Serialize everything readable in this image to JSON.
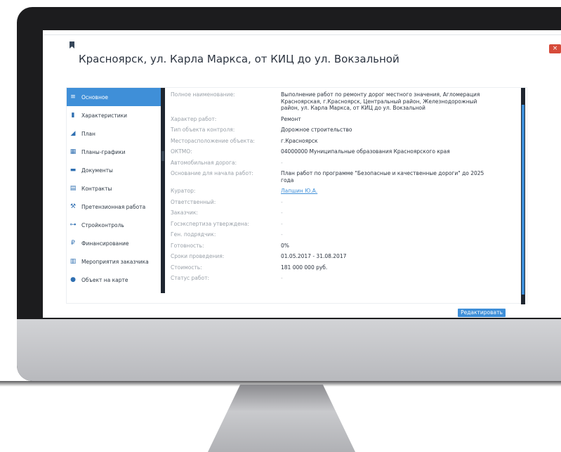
{
  "window": {
    "title": "Красноярск, ул. Карла Маркса, от КИЦ до ул. Вокзальной",
    "close_label": "×",
    "edit_button": "Редактировать"
  },
  "sidebar": {
    "items": [
      {
        "label": "Основное",
        "icon": "menu-icon",
        "glyph": "≡"
      },
      {
        "label": "Характеристики",
        "icon": "bar-chart-icon",
        "glyph": "▮"
      },
      {
        "label": "План",
        "icon": "area-chart-icon",
        "glyph": "◢"
      },
      {
        "label": "Планы-графики",
        "icon": "calendar-icon",
        "glyph": "▦"
      },
      {
        "label": "Документы",
        "icon": "folder-icon",
        "glyph": "▬"
      },
      {
        "label": "Контракты",
        "icon": "contract-icon",
        "glyph": "▤"
      },
      {
        "label": "Претензионная работа",
        "icon": "gavel-icon",
        "glyph": "⚒"
      },
      {
        "label": "Стройконтроль",
        "icon": "road-icon",
        "glyph": "⊶"
      },
      {
        "label": "Финансирование",
        "icon": "ruble-icon",
        "glyph": "₽"
      },
      {
        "label": "Мероприятия заказчика",
        "icon": "clipboard-icon",
        "glyph": "▥"
      },
      {
        "label": "Объект на карте",
        "icon": "map-pin-icon",
        "glyph": "●"
      }
    ]
  },
  "details": [
    {
      "label": "Полное наименование:",
      "value": "Выполнение работ по ремонту дорог местного значения, Агломерация Красноярская, г.Красноярск, Центральный район, Железнодорожный район, ул. Карла Маркса, от КИЦ до ул. Вокзальной"
    },
    {
      "label": "Характер работ:",
      "value": "Ремонт"
    },
    {
      "label": "Тип объекта контроля:",
      "value": "Дорожное строительство"
    },
    {
      "label": "Месторасположение объекта:",
      "value": "г.Красноярск"
    },
    {
      "label": "ОКТМО:",
      "value": "04000000 Муниципальные образования Красноярского края"
    },
    {
      "label": "Автомобильная дорога:",
      "value": "-"
    },
    {
      "label": "Основание для начала работ:",
      "value": "План работ по программе \"Безопасные и качественные дороги\" до 2025 года"
    },
    {
      "label": "Куратор:",
      "value": "Лапшин Ю.А."
    },
    {
      "label": "Ответственный:",
      "value": "-"
    },
    {
      "label": "Заказчик:",
      "value": "-"
    },
    {
      "label": "Госэкспертиза утверждена:",
      "value": "-"
    },
    {
      "label": "Ген. подрядчик:",
      "value": "-"
    },
    {
      "label": "Готовность:",
      "value": "0%"
    },
    {
      "label": "Сроки проведения:",
      "value": "01.05.2017 - 31.08.2017"
    },
    {
      "label": "Стоимость:",
      "value": "181 000 000 руб."
    },
    {
      "label": "Статус работ:",
      "value": "-"
    }
  ],
  "colors": {
    "accent": "#3f8fd8",
    "close": "#d64b3a",
    "text": "#2c3440",
    "label": "#9aa1a9"
  }
}
